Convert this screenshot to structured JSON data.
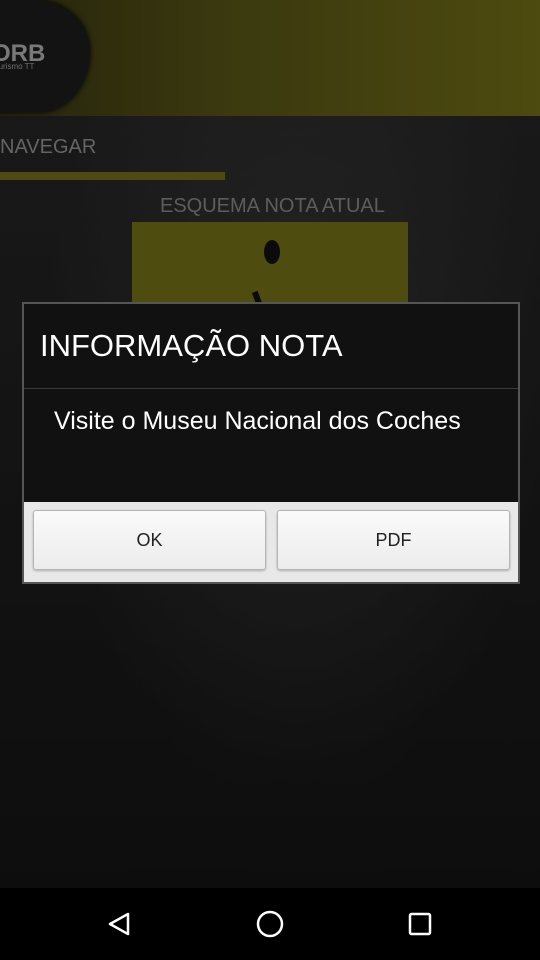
{
  "header": {
    "logo_title": "ORB",
    "logo_subtitle": "Turismo TT"
  },
  "nav": {
    "label": "NAVEGAR"
  },
  "section": {
    "title": "ESQUEMA NOTA ATUAL"
  },
  "dialog": {
    "title": "INFORMAÇÃO NOTA",
    "message": "Visite o Museu Nacional dos Coches",
    "buttons": {
      "ok": "OK",
      "pdf": "PDF"
    }
  },
  "system_nav": {
    "back_icon": "back-triangle-icon",
    "home_icon": "home-circle-icon",
    "recents_icon": "recents-square-icon"
  },
  "colors": {
    "accent_olive": "#7a7519",
    "dialog_bg": "#111111",
    "button_bg": "#e8e8e8"
  }
}
